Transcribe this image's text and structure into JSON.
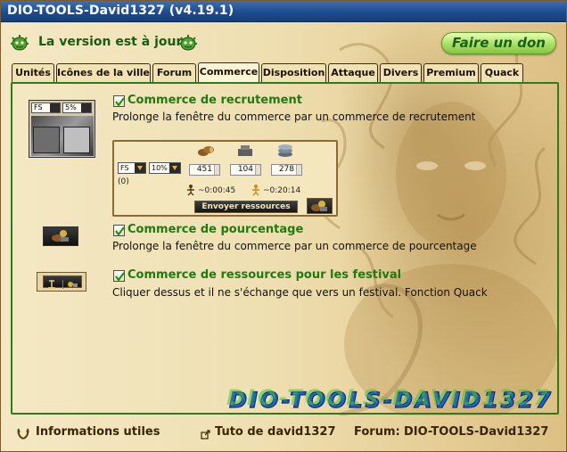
{
  "window": {
    "title": "DIO-TOOLS-David1327 (v4.19.1)"
  },
  "header": {
    "version_text": "La version est à jour",
    "donate_label": "Faire un don"
  },
  "tabs": [
    {
      "label": "Unités"
    },
    {
      "label": "Icônes de la ville"
    },
    {
      "label": "Forum"
    },
    {
      "label": "Commerce",
      "active": true
    },
    {
      "label": "Disposition"
    },
    {
      "label": "Attaque"
    },
    {
      "label": "Divers"
    },
    {
      "label": "Premium"
    },
    {
      "label": "Quack"
    }
  ],
  "options": [
    {
      "title": "Commerce de recrutement",
      "description": "Prolonge la fenêtre du commerce par un commerce de recrutement",
      "checked": true
    },
    {
      "title": "Commerce de pourcentage",
      "description": "Prolonge la fenêtre du commerce par un commerce de pourcentage",
      "checked": true
    },
    {
      "title": "Commerce de ressources pour les festival",
      "description": "Cliquer dessus et il ne s'échange que vers un festival. Fonction Quack",
      "checked": true
    }
  ],
  "thumbnail_recruit": {
    "select_1": "FS",
    "select_2": "5%"
  },
  "trade_preview": {
    "select_unit": "FS",
    "select_percent": "10%",
    "wood": "451",
    "stone": "104",
    "silver": "278",
    "count": "(0)",
    "time_1": "~0:00:45",
    "time_2": "~0:20:14",
    "send_button": "Envoyer ressources"
  },
  "signature": "DIO-TOOLS-DAVID1327",
  "footer": {
    "info_link": "Informations utiles",
    "tutorial_link": "Tuto de david1327",
    "forum_label": "Forum:",
    "forum_link": "DIO-TOOLS-David1327"
  },
  "colors": {
    "title_bar": "#1b4a8c",
    "option_title": "#207a10",
    "panel_border": "#2e7b1f",
    "donate_button": "#a7e062"
  }
}
